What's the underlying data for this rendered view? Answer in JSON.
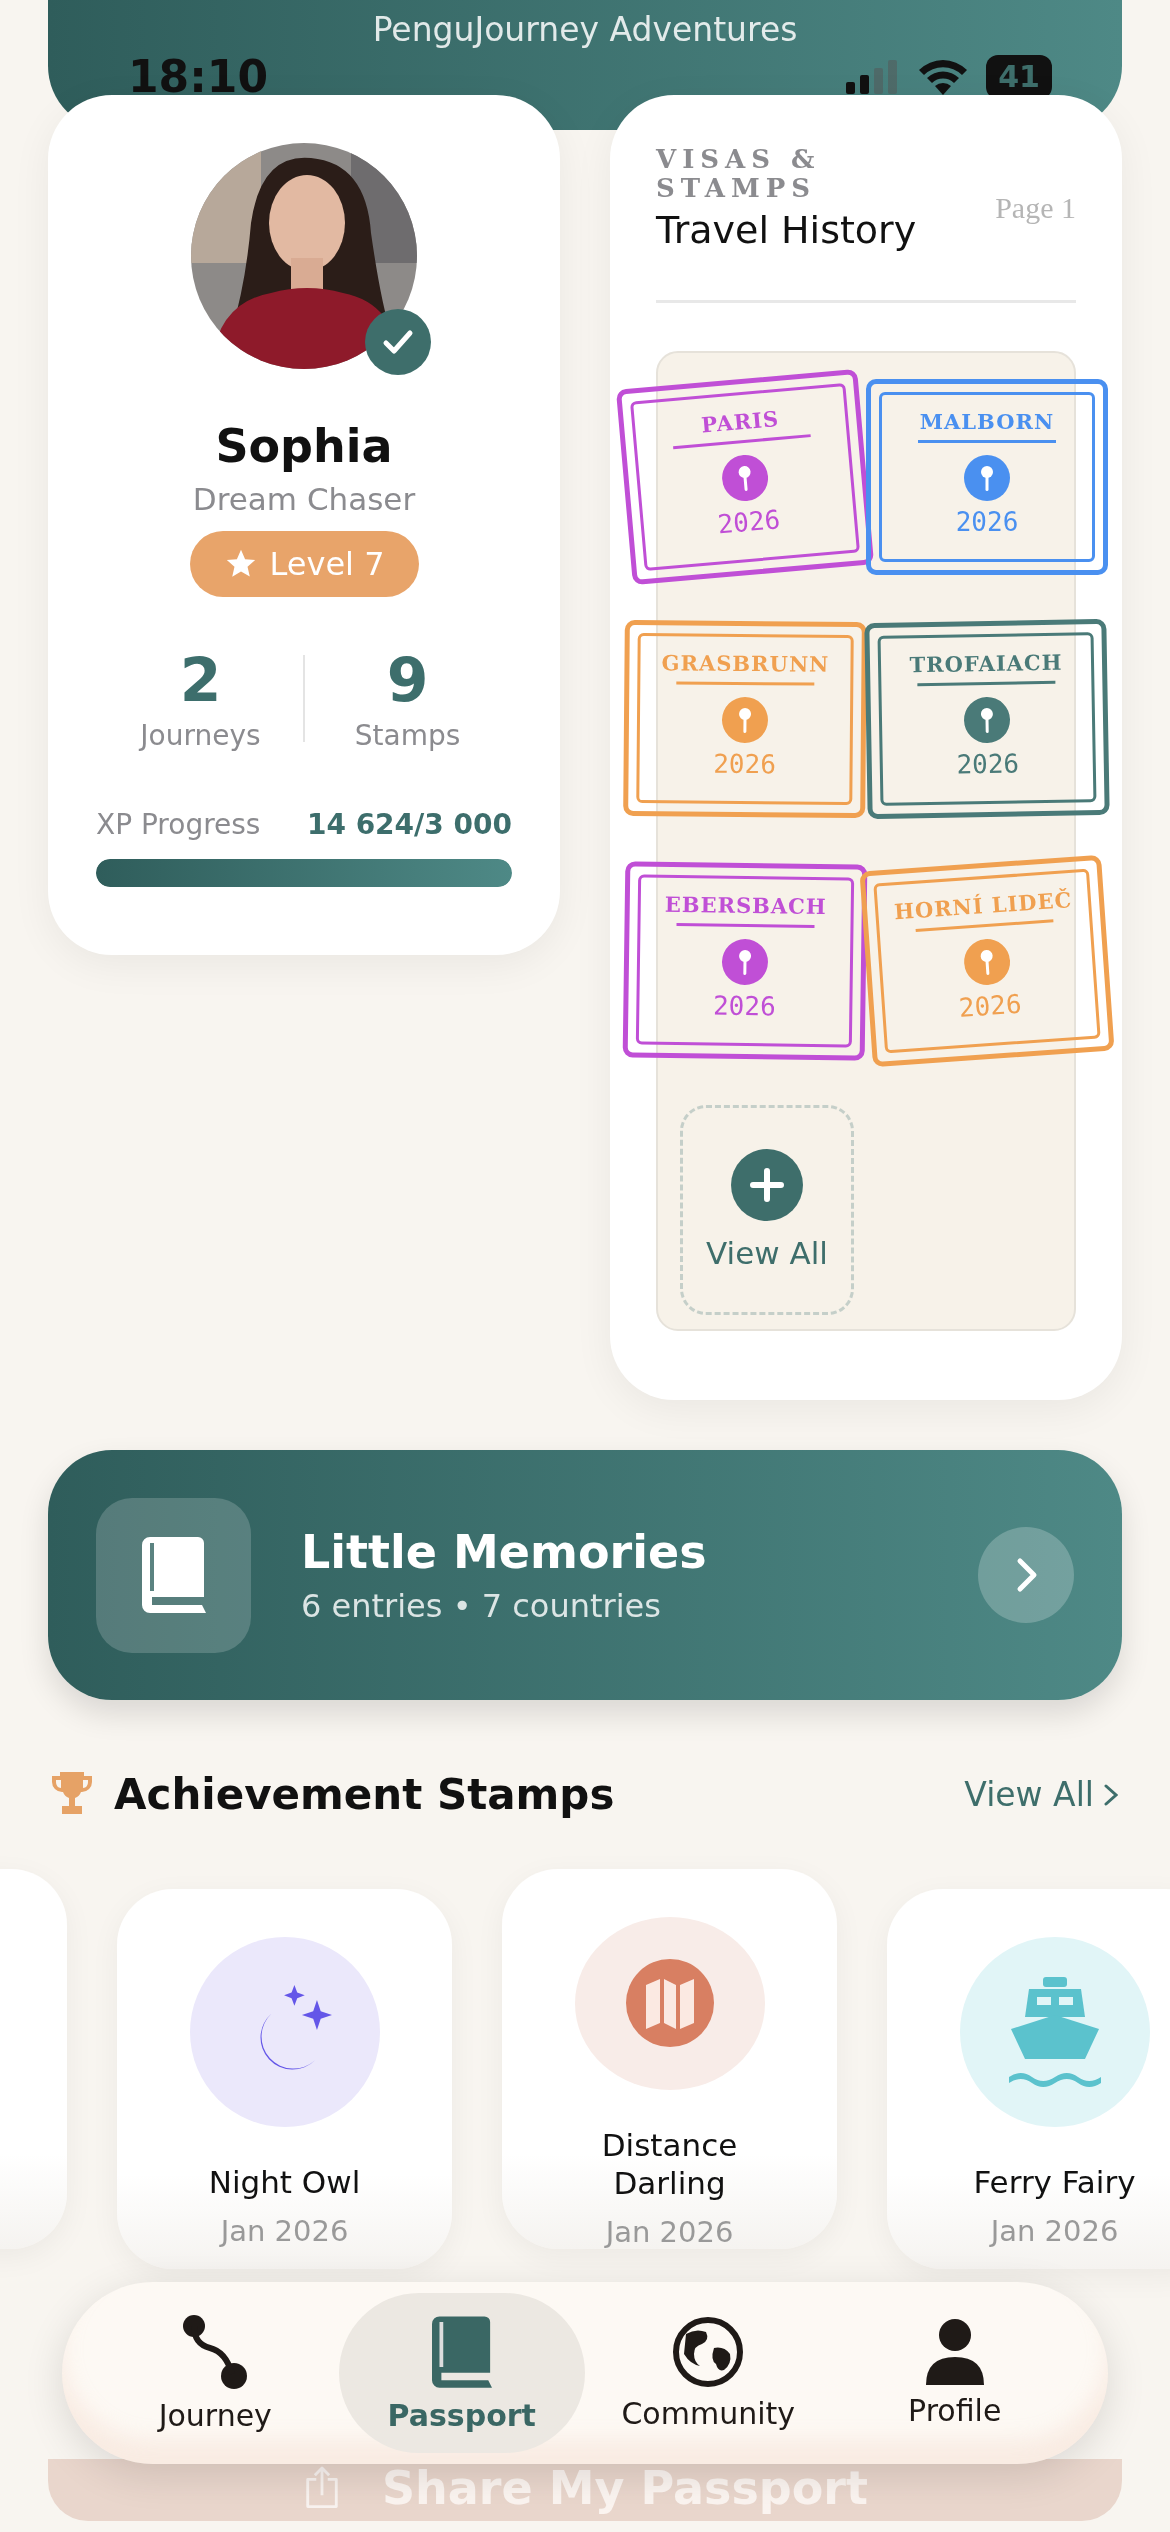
{
  "app_title": "PenguJourney Adventures",
  "status_bar": {
    "time": "18:10",
    "battery": "41"
  },
  "profile": {
    "name": "Sophia",
    "title": "Dream Chaser",
    "verified": true,
    "level": "Level 7",
    "stats": [
      {
        "value": "2",
        "label": "Journeys"
      },
      {
        "value": "9",
        "label": "Stamps"
      }
    ],
    "xp": {
      "label": "XP Progress",
      "value": "14 624/3 000",
      "level": 1
    }
  },
  "passport": {
    "eyebrow": "VISAS & STAMPS",
    "page": "Page 1",
    "title": "Travel History",
    "stamps": [
      {
        "city": "PARIS",
        "year": "2026",
        "color": "#c04fd6"
      },
      {
        "city": "MALBORN",
        "year": "2026",
        "color": "#4a90f0"
      },
      {
        "city": "GRASBRUNN",
        "year": "2026",
        "color": "#f0a050"
      },
      {
        "city": "TROFAIACH",
        "year": "2026",
        "color": "#4a7a78"
      },
      {
        "city": "EBERSBACH",
        "year": "2026",
        "color": "#c04fd6"
      },
      {
        "city": "HORNÍ LIDEČ",
        "year": "2026",
        "color": "#f0a050"
      }
    ],
    "view_all": "View All"
  },
  "memories": {
    "title": "Little Memories",
    "subtitle": "6 entries • 7 countries"
  },
  "achievements": {
    "title": "Achievement Stamps",
    "view_all": "View All",
    "items": [
      {
        "kind": "moon",
        "name": "Night Owl",
        "date": "Jan 2026",
        "color": "#6456e8"
      },
      {
        "kind": "map",
        "name": "Distance Darling",
        "date": "Jan 2026",
        "color": "#d87f62"
      },
      {
        "kind": "ship",
        "name": "Ferry Fairy",
        "date": "Jan 2026",
        "color": "#5bc2cd"
      }
    ]
  },
  "share_button": "Share My Passport",
  "nav": [
    {
      "kind": "route",
      "label": "Journey",
      "selected": false
    },
    {
      "kind": "book",
      "label": "Passport",
      "selected": true
    },
    {
      "kind": "globe",
      "label": "Community",
      "selected": false
    },
    {
      "kind": "person",
      "label": "Profile",
      "selected": false
    }
  ]
}
